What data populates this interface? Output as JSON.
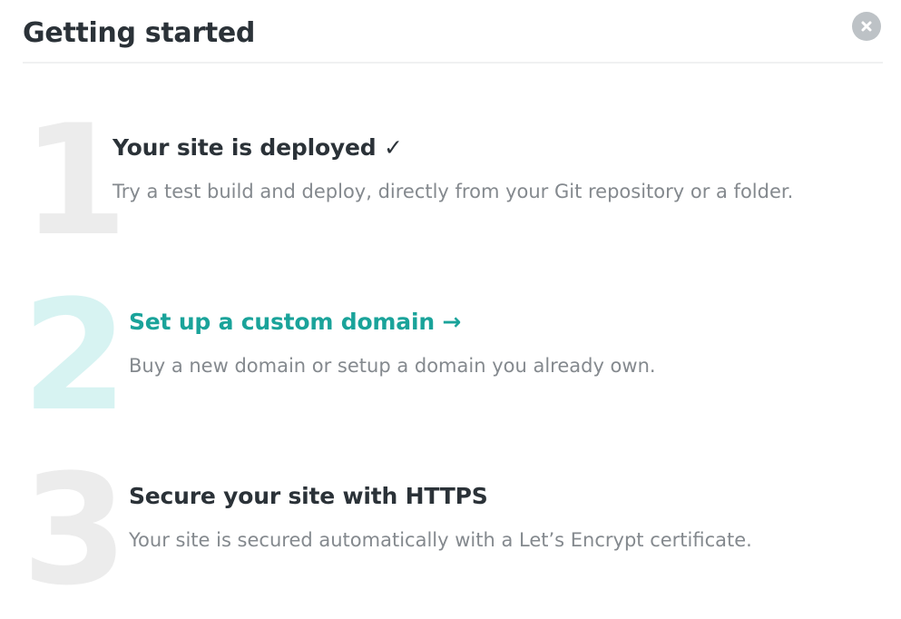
{
  "page": {
    "title": "Getting started",
    "close_icon": "close-circle-icon"
  },
  "steps": [
    {
      "number": "1",
      "heading": "Your site is deployed ✓",
      "description": "Try a test build and deploy, directly from your Git repository or a folder.",
      "state": "completed"
    },
    {
      "number": "2",
      "heading": "Set up a custom domain →",
      "description": "Buy a new domain or setup a domain you already own.",
      "state": "active"
    },
    {
      "number": "3",
      "heading": "Secure your site with HTTPS",
      "description": "Your site is secured automatically with a Let’s Encrypt certificate.",
      "state": "pending"
    }
  ],
  "colors": {
    "accent": "#1aa39a",
    "heading": "#2b3238",
    "muted": "#84898e",
    "number_inactive": "#ececec",
    "number_active": "#d7f3f2",
    "close_bg": "#bdc2c6"
  }
}
